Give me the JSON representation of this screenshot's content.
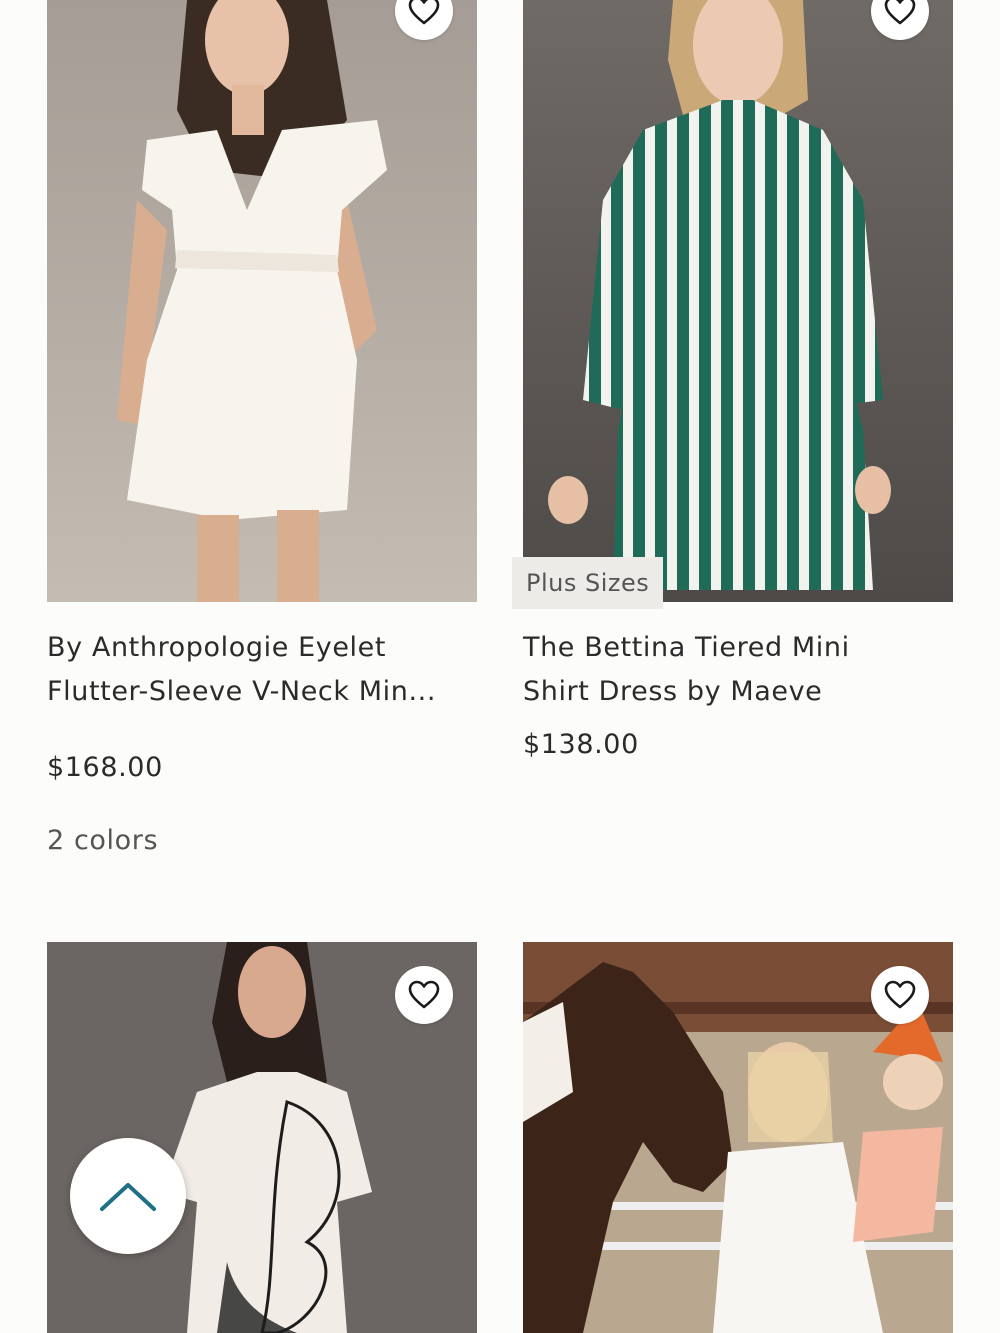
{
  "products": [
    {
      "title_line1": "By Anthropologie Eyelet",
      "title_line2": "Flutter-Sleeve V-Neck Min...",
      "price": "$168.00",
      "colors": "2 colors",
      "image_alt": "Woman in white eyelet flutter-sleeve V-neck mini dress"
    },
    {
      "title_line1": "The Bettina Tiered Mini",
      "title_line2": "Shirt Dress by Maeve",
      "price": "$138.00",
      "badge": "Plus Sizes",
      "image_alt": "Woman in green and white striped tiered shirt dress"
    },
    {
      "image_alt": "Woman in white dress with black butterfly print"
    },
    {
      "image_alt": "Mother holding child next to a horse"
    }
  ],
  "icons": {
    "favorite": "heart-outline-icon",
    "scroll_top": "chevron-up-icon"
  },
  "colors": {
    "accent": "#1f6f86",
    "background": "#fcfcfa"
  }
}
